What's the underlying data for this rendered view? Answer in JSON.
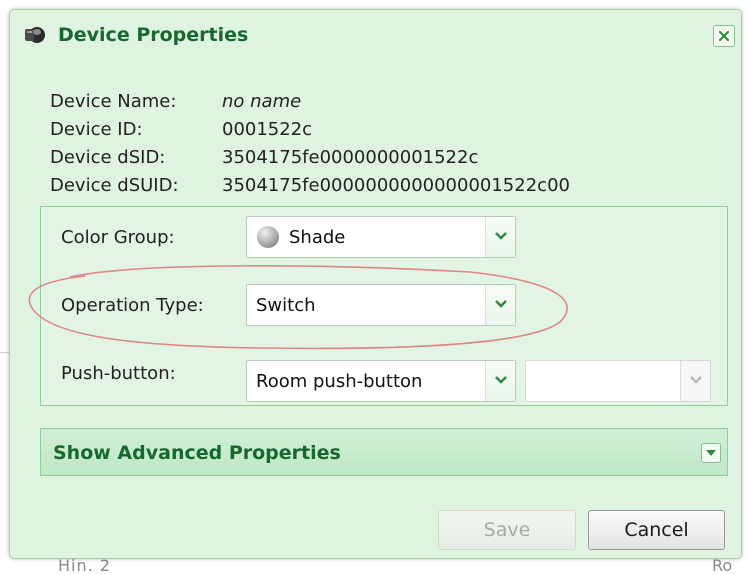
{
  "dialog": {
    "title": "Device Properties",
    "close_label": "✕"
  },
  "device": {
    "name_label": "Device Name:",
    "name_value": "no name",
    "id_label": "Device ID:",
    "id_value": "0001522c",
    "dsid_label": "Device dSID:",
    "dsid_value": "3504175fe0000000001522c",
    "dsuid_label": "Device dSUID:",
    "dsuid_value": "3504175fe0000000000000001522c00"
  },
  "form": {
    "color_group_label": "Color Group:",
    "color_group_value": "Shade",
    "operation_type_label": "Operation Type:",
    "operation_type_value": "Switch",
    "push_button_label": "Push-button:",
    "push_button_value": "Room push-button",
    "push_button_secondary_value": ""
  },
  "advanced": {
    "label": "Show Advanced Properties"
  },
  "buttons": {
    "save_label": "Save",
    "cancel_label": "Cancel"
  },
  "background": {
    "left_fragment": "Hin. 2",
    "right_fragment": "Ro"
  },
  "colors": {
    "accent": "#16692e",
    "panel_bg": "#dff3e1",
    "highlight_circle": "#e07a7a"
  }
}
